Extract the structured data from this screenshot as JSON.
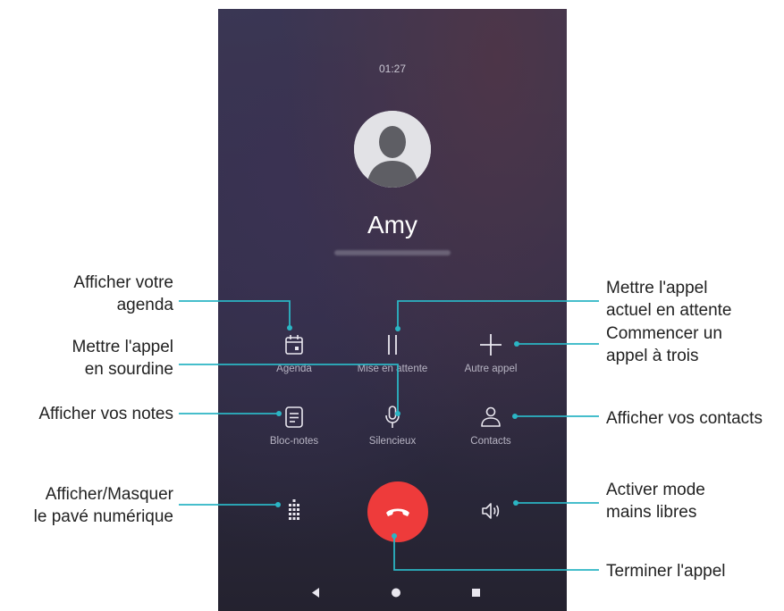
{
  "call": {
    "timer": "01:27",
    "contact_name": "Amy"
  },
  "buttons": {
    "agenda": "Agenda",
    "hold": "Mise en attente",
    "add_call": "Autre appel",
    "notes": "Bloc-notes",
    "mute": "Silencieux",
    "contacts": "Contacts"
  },
  "icons": [
    "calendar-icon",
    "pause-icon",
    "plus-icon",
    "notes-icon",
    "microphone-icon",
    "contacts-icon",
    "dialpad-icon",
    "end-call-icon",
    "speaker-icon",
    "back-icon",
    "home-icon",
    "recents-icon"
  ],
  "callouts": {
    "agenda": [
      "Afficher votre",
      "agenda"
    ],
    "mute": [
      "Mettre l'appel",
      "en sourdine"
    ],
    "notes": "Afficher vos notes",
    "dialpad": [
      "Afficher/Masquer",
      "le pavé numérique"
    ],
    "hold": [
      "Mettre l'appel",
      "actuel en attente"
    ],
    "three_way": [
      "Commencer un",
      "appel à trois"
    ],
    "contacts": "Afficher vos contacts",
    "speaker": [
      "Activer mode",
      "mains libres"
    ],
    "end_call": "Terminer l'appel"
  },
  "colors": {
    "end_call": "#ee3b3b",
    "callout_line": "#2bb5c4"
  }
}
